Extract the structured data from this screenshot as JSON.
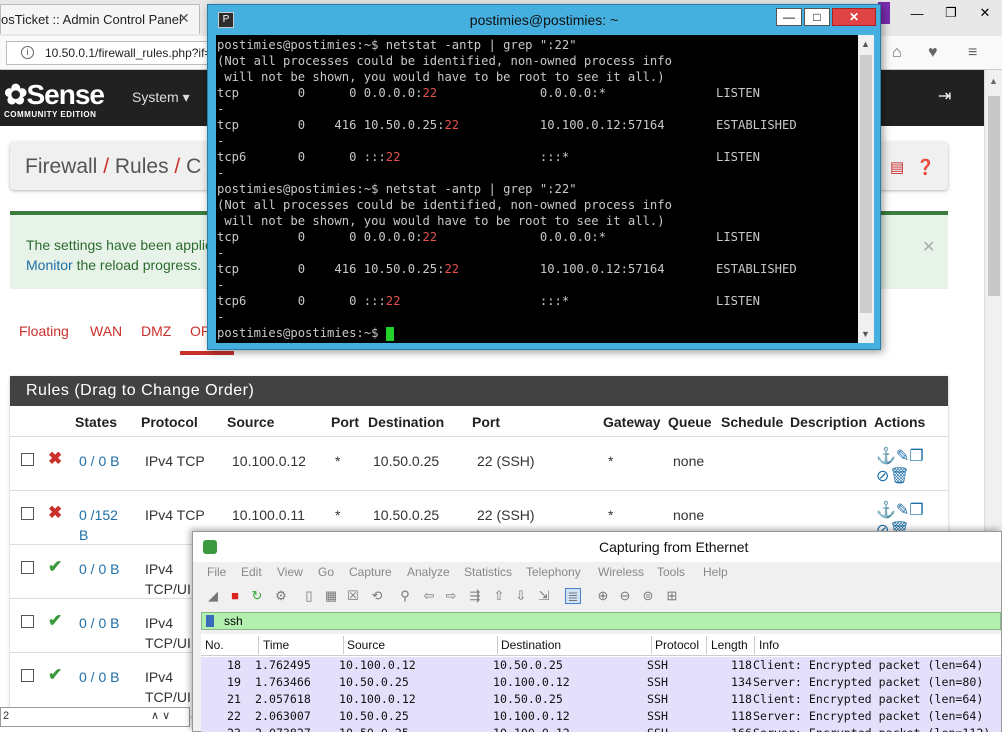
{
  "browser": {
    "tab_title": "osTicket :: Admin Control Panel",
    "url": "10.50.0.1/firewall_rules.php?if="
  },
  "pfsense": {
    "logo_main": "Sense",
    "logo_sub": "COMMUNITY EDITION",
    "menu_system": "System ▾",
    "breadcrumb": {
      "part1": "Firewall",
      "part2": "Rules",
      "part3": "C",
      "sep": "/"
    },
    "alert": {
      "text_line1": "The settings have been applie",
      "link": "Monitor",
      "text_line2": "the reload progress."
    },
    "tabs": [
      "Floating",
      "WAN",
      "DMZ",
      "OP"
    ],
    "rules_title": "Rules (Drag to Change Order)",
    "columns": [
      "States",
      "Protocol",
      "Source",
      "Port",
      "Destination",
      "Port",
      "Gateway",
      "Queue",
      "Schedule",
      "Description",
      "Actions"
    ],
    "rows": [
      {
        "status": "blocked",
        "states_l1": "0 / 0 B",
        "states_l2": "",
        "proto_l1": "IPv4 TCP",
        "proto_l2": "",
        "source": "10.100.0.12",
        "sport": "*",
        "dest": "10.50.0.25",
        "dport": "22 (SSH)",
        "gateway": "*",
        "queue": "none"
      },
      {
        "status": "blocked",
        "states_l1": "0 /152",
        "states_l2": "B",
        "proto_l1": "IPv4 TCP",
        "proto_l2": "",
        "source": "10.100.0.11",
        "sport": "*",
        "dest": "10.50.0.25",
        "dport": "22 (SSH)",
        "gateway": "*",
        "queue": "none"
      },
      {
        "status": "pass",
        "states_l1": "0 / 0 B",
        "states_l2": "",
        "proto_l1": "IPv4",
        "proto_l2": "TCP/UI",
        "source": "",
        "sport": "",
        "dest": "",
        "dport": "",
        "gateway": "",
        "queue": ""
      },
      {
        "status": "pass",
        "states_l1": "0 / 0 B",
        "states_l2": "",
        "proto_l1": "IPv4",
        "proto_l2": "TCP/UI",
        "source": "",
        "sport": "",
        "dest": "",
        "dport": "",
        "gateway": "",
        "queue": ""
      },
      {
        "status": "pass",
        "states_l1": "0 / 0 B",
        "states_l2": "",
        "proto_l1": "IPv4",
        "proto_l2": "TCP/UI",
        "source": "",
        "sport": "",
        "dest": "",
        "dport": "",
        "gateway": "",
        "queue": ""
      }
    ],
    "bottom_input": "2"
  },
  "terminal": {
    "title": "postimies@postimies: ~",
    "lines": [
      "postimies@postimies:~$ netstat -antp | grep \":22\"",
      "(Not all processes could be identified, non-owned process info",
      " will not be shown, you would have to be root to see it all.)",
      "tcp        0      0 0.0.0.0:22              0.0.0.0:*               LISTEN",
      "-",
      "tcp        0    416 10.50.0.25:22           10.100.0.12:57164       ESTABLISHED",
      "-",
      "tcp6       0      0 :::22                   :::*                    LISTEN",
      "-",
      "postimies@postimies:~$ netstat -antp | grep \":22\"",
      "(Not all processes could be identified, non-owned process info",
      " will not be shown, you would have to be root to see it all.)",
      "tcp        0      0 0.0.0.0:22              0.0.0.0:*               LISTEN",
      "-",
      "tcp        0    416 10.50.0.25:22           10.100.0.12:57164       ESTABLISHED",
      "-",
      "tcp6       0      0 :::22                   :::*                    LISTEN",
      "-",
      "postimies@postimies:~$ "
    ]
  },
  "wireshark": {
    "title": "Capturing from Ethernet",
    "menu": [
      "File",
      "Edit",
      "View",
      "Go",
      "Capture",
      "Analyze",
      "Statistics",
      "Telephony",
      "Wireless",
      "Tools",
      "Help"
    ],
    "filter": "ssh",
    "columns": [
      "No.",
      "Time",
      "Source",
      "Destination",
      "Protocol",
      "Length",
      "Info"
    ],
    "packets": [
      {
        "no": "18",
        "time": "1.762495",
        "src": "10.100.0.12",
        "dst": "10.50.0.25",
        "proto": "SSH",
        "len": "118",
        "info": "Client: Encrypted packet (len=64)"
      },
      {
        "no": "19",
        "time": "1.763466",
        "src": "10.50.0.25",
        "dst": "10.100.0.12",
        "proto": "SSH",
        "len": "134",
        "info": "Server: Encrypted packet (len=80)"
      },
      {
        "no": "21",
        "time": "2.057618",
        "src": "10.100.0.12",
        "dst": "10.50.0.25",
        "proto": "SSH",
        "len": "118",
        "info": "Client: Encrypted packet (len=64)"
      },
      {
        "no": "22",
        "time": "2.063007",
        "src": "10.50.0.25",
        "dst": "10.100.0.12",
        "proto": "SSH",
        "len": "118",
        "info": "Server: Encrypted packet (len=64)"
      },
      {
        "no": "23",
        "time": "2.073827",
        "src": "10.50.0.25",
        "dst": "10.100.0.12",
        "proto": "SSH",
        "len": "166",
        "info": "Server: Encrypted packet (len=112)"
      }
    ]
  },
  "colors": {
    "pfsense_red": "#c9302c",
    "terminal_titlebar": "#45b0e0",
    "wireshark_filter_ok": "#b3f0b0",
    "packet_row": "#e4e0fb"
  }
}
